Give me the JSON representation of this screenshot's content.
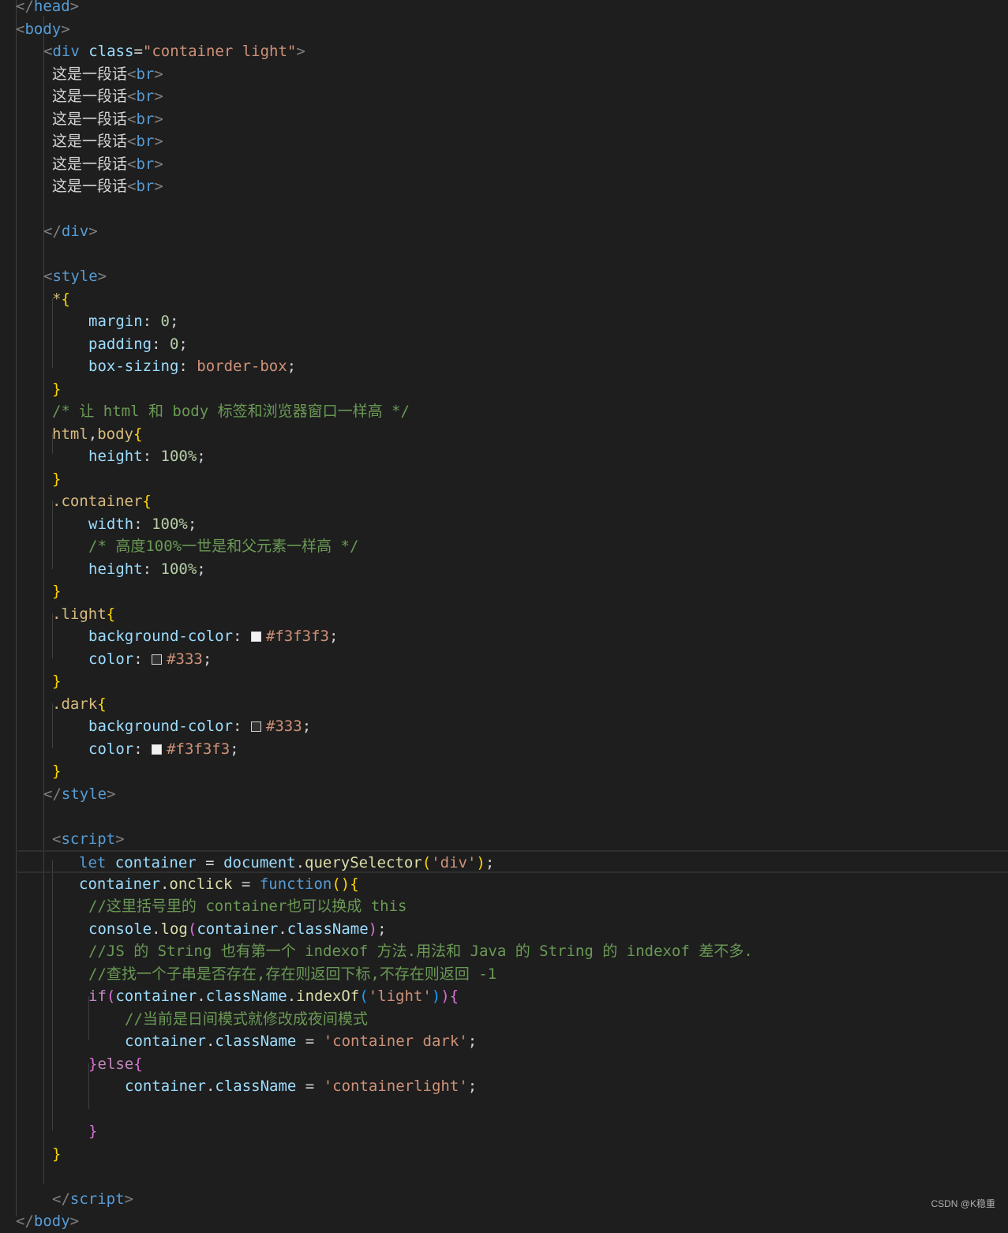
{
  "editor": {
    "lines": [
      {
        "indent": 0,
        "parts": [
          {
            "t": "</",
            "c": "br"
          },
          {
            "t": "head",
            "c": "tag"
          },
          {
            "t": ">",
            "c": "br"
          }
        ]
      },
      {
        "indent": 0,
        "parts": [
          {
            "t": "<",
            "c": "br"
          },
          {
            "t": "body",
            "c": "tag"
          },
          {
            "t": ">",
            "c": "br"
          }
        ]
      },
      {
        "indent": 1,
        "parts": [
          {
            "t": "<",
            "c": "br"
          },
          {
            "t": "div",
            "c": "tag"
          },
          {
            "t": " "
          },
          {
            "t": "class",
            "c": "attr"
          },
          {
            "t": "="
          },
          {
            "t": "\"container light\"",
            "c": "str"
          },
          {
            "t": ">",
            "c": "br"
          }
        ]
      },
      {
        "indent": 2,
        "parts": [
          {
            "t": "这是一段话",
            "c": "txt cjk"
          },
          {
            "t": "<",
            "c": "br"
          },
          {
            "t": "br",
            "c": "tag"
          },
          {
            "t": ">",
            "c": "br"
          }
        ]
      },
      {
        "indent": 2,
        "parts": [
          {
            "t": "这是一段话",
            "c": "txt cjk"
          },
          {
            "t": "<",
            "c": "br"
          },
          {
            "t": "br",
            "c": "tag"
          },
          {
            "t": ">",
            "c": "br"
          }
        ]
      },
      {
        "indent": 2,
        "parts": [
          {
            "t": "这是一段话",
            "c": "txt cjk"
          },
          {
            "t": "<",
            "c": "br"
          },
          {
            "t": "br",
            "c": "tag"
          },
          {
            "t": ">",
            "c": "br"
          }
        ]
      },
      {
        "indent": 2,
        "parts": [
          {
            "t": "这是一段话",
            "c": "txt cjk"
          },
          {
            "t": "<",
            "c": "br"
          },
          {
            "t": "br",
            "c": "tag"
          },
          {
            "t": ">",
            "c": "br"
          }
        ]
      },
      {
        "indent": 2,
        "parts": [
          {
            "t": "这是一段话",
            "c": "txt cjk"
          },
          {
            "t": "<",
            "c": "br"
          },
          {
            "t": "br",
            "c": "tag"
          },
          {
            "t": ">",
            "c": "br"
          }
        ]
      },
      {
        "indent": 2,
        "parts": [
          {
            "t": "这是一段话",
            "c": "txt cjk"
          },
          {
            "t": "<",
            "c": "br"
          },
          {
            "t": "br",
            "c": "tag"
          },
          {
            "t": ">",
            "c": "br"
          }
        ]
      },
      {
        "indent": 0,
        "parts": []
      },
      {
        "indent": 1,
        "parts": [
          {
            "t": "</",
            "c": "br"
          },
          {
            "t": "div",
            "c": "tag"
          },
          {
            "t": ">",
            "c": "br"
          }
        ]
      },
      {
        "indent": 0,
        "parts": []
      },
      {
        "indent": 1,
        "parts": [
          {
            "t": "<",
            "c": "br"
          },
          {
            "t": "style",
            "c": "tag"
          },
          {
            "t": ">",
            "c": "br"
          }
        ]
      },
      {
        "indent": 2,
        "parts": [
          {
            "t": "*",
            "c": "sel"
          },
          {
            "t": "{",
            "c": "b1"
          }
        ]
      },
      {
        "indent": 4,
        "parts": [
          {
            "t": "margin",
            "c": "prop"
          },
          {
            "t": ": "
          },
          {
            "t": "0",
            "c": "num"
          },
          {
            "t": ";"
          }
        ]
      },
      {
        "indent": 4,
        "parts": [
          {
            "t": "padding",
            "c": "prop"
          },
          {
            "t": ": "
          },
          {
            "t": "0",
            "c": "num"
          },
          {
            "t": ";"
          }
        ]
      },
      {
        "indent": 4,
        "parts": [
          {
            "t": "box-sizing",
            "c": "prop"
          },
          {
            "t": ": "
          },
          {
            "t": "border-box",
            "c": "str"
          },
          {
            "t": ";"
          }
        ]
      },
      {
        "indent": 2,
        "parts": [
          {
            "t": "}",
            "c": "b1"
          }
        ]
      },
      {
        "indent": 2,
        "parts": [
          {
            "t": "/* 让 html 和 body 标签和浏览器窗口一样高 */",
            "c": "cmt"
          }
        ]
      },
      {
        "indent": 2,
        "parts": [
          {
            "t": "html",
            "c": "sel"
          },
          {
            "t": ","
          },
          {
            "t": "body",
            "c": "sel"
          },
          {
            "t": "{",
            "c": "b1"
          }
        ]
      },
      {
        "indent": 4,
        "parts": [
          {
            "t": "height",
            "c": "prop"
          },
          {
            "t": ": "
          },
          {
            "t": "100%",
            "c": "num"
          },
          {
            "t": ";"
          }
        ]
      },
      {
        "indent": 2,
        "parts": [
          {
            "t": "}",
            "c": "b1"
          }
        ]
      },
      {
        "indent": 2,
        "parts": [
          {
            "t": ".container",
            "c": "sel"
          },
          {
            "t": "{",
            "c": "b1"
          }
        ]
      },
      {
        "indent": 4,
        "parts": [
          {
            "t": "width",
            "c": "prop"
          },
          {
            "t": ": "
          },
          {
            "t": "100%",
            "c": "num"
          },
          {
            "t": ";"
          }
        ]
      },
      {
        "indent": 4,
        "parts": [
          {
            "t": "/* 高度100%一世是和父元素一样高 */",
            "c": "cmt"
          }
        ]
      },
      {
        "indent": 4,
        "parts": [
          {
            "t": "height",
            "c": "prop"
          },
          {
            "t": ": "
          },
          {
            "t": "100%",
            "c": "num"
          },
          {
            "t": ";"
          }
        ]
      },
      {
        "indent": 2,
        "parts": [
          {
            "t": "}",
            "c": "b1"
          }
        ]
      },
      {
        "indent": 2,
        "parts": [
          {
            "t": ".light",
            "c": "sel"
          },
          {
            "t": "{",
            "c": "b1"
          }
        ]
      },
      {
        "indent": 4,
        "parts": [
          {
            "t": "background-color",
            "c": "prop"
          },
          {
            "t": ": "
          },
          {
            "swatch": "#f3f3f3"
          },
          {
            "t": "#f3f3f3",
            "c": "str"
          },
          {
            "t": ";"
          }
        ]
      },
      {
        "indent": 4,
        "parts": [
          {
            "t": "color",
            "c": "prop"
          },
          {
            "t": ": "
          },
          {
            "swatch": "#333333"
          },
          {
            "t": "#333",
            "c": "str"
          },
          {
            "t": ";"
          }
        ]
      },
      {
        "indent": 2,
        "parts": [
          {
            "t": "}",
            "c": "b1"
          }
        ]
      },
      {
        "indent": 2,
        "parts": [
          {
            "t": ".dark",
            "c": "sel"
          },
          {
            "t": "{",
            "c": "b1"
          }
        ]
      },
      {
        "indent": 4,
        "parts": [
          {
            "t": "background-color",
            "c": "prop"
          },
          {
            "t": ": "
          },
          {
            "swatch": "#333333"
          },
          {
            "t": "#333",
            "c": "str"
          },
          {
            "t": ";"
          }
        ]
      },
      {
        "indent": 4,
        "parts": [
          {
            "t": "color",
            "c": "prop"
          },
          {
            "t": ": "
          },
          {
            "swatch": "#f3f3f3"
          },
          {
            "t": "#f3f3f3",
            "c": "str"
          },
          {
            "t": ";"
          }
        ]
      },
      {
        "indent": 2,
        "parts": [
          {
            "t": "}",
            "c": "b1"
          }
        ]
      },
      {
        "indent": 1,
        "parts": [
          {
            "t": "</",
            "c": "br"
          },
          {
            "t": "style",
            "c": "tag"
          },
          {
            "t": ">",
            "c": "br"
          }
        ]
      },
      {
        "indent": 0,
        "parts": []
      },
      {
        "indent": 2,
        "parts": [
          {
            "t": "<",
            "c": "br"
          },
          {
            "t": "script",
            "c": "tag"
          },
          {
            "t": ">",
            "c": "br"
          }
        ]
      },
      {
        "indent": 3,
        "current": true,
        "parts": [
          {
            "t": "let",
            "c": "kw"
          },
          {
            "t": " "
          },
          {
            "t": "container",
            "c": "var"
          },
          {
            "t": " = "
          },
          {
            "t": "document",
            "c": "var"
          },
          {
            "t": "."
          },
          {
            "t": "querySelector",
            "c": "fn"
          },
          {
            "t": "(",
            "c": "b1"
          },
          {
            "t": "'div'",
            "c": "str"
          },
          {
            "t": ")",
            "c": "b1"
          },
          {
            "t": ";"
          }
        ]
      },
      {
        "indent": 3,
        "parts": [
          {
            "t": "container",
            "c": "var"
          },
          {
            "t": "."
          },
          {
            "t": "onclick",
            "c": "fn"
          },
          {
            "t": " = "
          },
          {
            "t": "function",
            "c": "kw"
          },
          {
            "t": "(){",
            "c": "b1"
          }
        ]
      },
      {
        "indent": 4,
        "parts": [
          {
            "t": "//这里括号里的 container也可以换成 this",
            "c": "cmt"
          }
        ]
      },
      {
        "indent": 4,
        "parts": [
          {
            "t": "console",
            "c": "var"
          },
          {
            "t": "."
          },
          {
            "t": "log",
            "c": "fn"
          },
          {
            "t": "(",
            "c": "b2"
          },
          {
            "t": "container",
            "c": "var"
          },
          {
            "t": "."
          },
          {
            "t": "className",
            "c": "var"
          },
          {
            "t": ")",
            "c": "b2"
          },
          {
            "t": ";"
          }
        ]
      },
      {
        "indent": 4,
        "parts": [
          {
            "t": "//JS 的 String 也有第一个 indexof 方法.用法和 Java 的 String 的 indexof 差不多.",
            "c": "cmt"
          }
        ]
      },
      {
        "indent": 4,
        "parts": [
          {
            "t": "//查找一个子串是否存在,存在则返回下标,不存在则返回 -1",
            "c": "cmt"
          }
        ]
      },
      {
        "indent": 4,
        "parts": [
          {
            "t": "if",
            "c": "kw2"
          },
          {
            "t": "(",
            "c": "b2"
          },
          {
            "t": "container",
            "c": "var"
          },
          {
            "t": "."
          },
          {
            "t": "className",
            "c": "var"
          },
          {
            "t": "."
          },
          {
            "t": "indexOf",
            "c": "fn"
          },
          {
            "t": "(",
            "c": "b3"
          },
          {
            "t": "'light'",
            "c": "str"
          },
          {
            "t": ")",
            "c": "b3"
          },
          {
            "t": "){",
            "c": "b2"
          }
        ]
      },
      {
        "indent": 6,
        "parts": [
          {
            "t": "//当前是日间模式就修改成夜间模式",
            "c": "cmt"
          }
        ]
      },
      {
        "indent": 6,
        "parts": [
          {
            "t": "container",
            "c": "var"
          },
          {
            "t": "."
          },
          {
            "t": "className",
            "c": "var"
          },
          {
            "t": " = "
          },
          {
            "t": "'container dark'",
            "c": "str"
          },
          {
            "t": ";"
          }
        ]
      },
      {
        "indent": 4,
        "parts": [
          {
            "t": "}",
            "c": "b2"
          },
          {
            "t": "else",
            "c": "kw2"
          },
          {
            "t": "{",
            "c": "b2"
          }
        ]
      },
      {
        "indent": 6,
        "parts": [
          {
            "t": "container",
            "c": "var"
          },
          {
            "t": "."
          },
          {
            "t": "className",
            "c": "var"
          },
          {
            "t": " = "
          },
          {
            "t": "'containerlight'",
            "c": "str"
          },
          {
            "t": ";"
          }
        ]
      },
      {
        "indent": 0,
        "parts": []
      },
      {
        "indent": 4,
        "parts": [
          {
            "t": "}",
            "c": "b2"
          }
        ]
      },
      {
        "indent": 2,
        "parts": [
          {
            "t": "}",
            "c": "b1"
          }
        ]
      },
      {
        "indent": 0,
        "parts": []
      },
      {
        "indent": 2,
        "parts": [
          {
            "t": "</",
            "c": "br"
          },
          {
            "t": "script",
            "c": "tag"
          },
          {
            "t": ">",
            "c": "br"
          }
        ]
      },
      {
        "indent": 0,
        "parts": [
          {
            "t": "</",
            "c": "br"
          },
          {
            "t": "body",
            "c": "tag"
          },
          {
            "t": ">",
            "c": "br"
          }
        ]
      }
    ]
  },
  "watermark": "CSDN @K稳重"
}
